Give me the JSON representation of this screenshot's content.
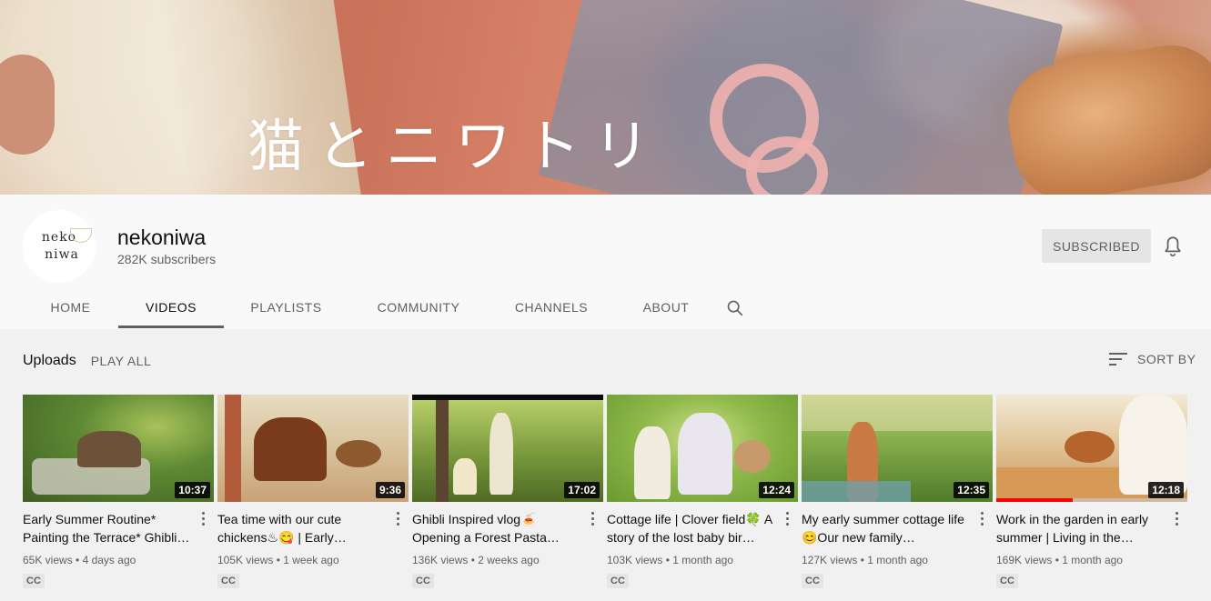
{
  "banner": {
    "title": "猫とニワトリ"
  },
  "channel": {
    "avatar_line1": "neko",
    "avatar_line2": "niwa",
    "name": "nekoniwa",
    "subscribers": "282K subscribers",
    "subscribe_label": "SUBSCRIBED"
  },
  "tabs": [
    {
      "label": "HOME"
    },
    {
      "label": "VIDEOS",
      "active": true
    },
    {
      "label": "PLAYLISTS"
    },
    {
      "label": "COMMUNITY"
    },
    {
      "label": "CHANNELS"
    },
    {
      "label": "ABOUT"
    }
  ],
  "uploads": {
    "title": "Uploads",
    "play_all": "PLAY ALL",
    "sort_by": "SORT BY"
  },
  "videos": [
    {
      "title": "Early Summer Routine* Painting the Terrace* Ghibli…",
      "duration": "10:37",
      "views": "65K views",
      "age": "4 days ago",
      "badge": "CC"
    },
    {
      "title": "Tea time with our cute chickens♨😋 | Early…",
      "duration": "9:36",
      "views": "105K views",
      "age": "1 week ago",
      "badge": "CC"
    },
    {
      "title": "Ghibli Inspired vlog🍝 Opening a Forest Pasta…",
      "duration": "17:02",
      "views": "136K views",
      "age": "2 weeks ago",
      "badge": "CC"
    },
    {
      "title": "Cottage life | Clover field🍀 A story of the lost baby bir…",
      "duration": "12:24",
      "views": "103K views",
      "age": "1 month ago",
      "badge": "CC"
    },
    {
      "title": "My early summer cottage life😊Our new family…",
      "duration": "12:35",
      "views": "127K views",
      "age": "1 month ago",
      "badge": "CC"
    },
    {
      "title": "Work in the garden in early summer | Living in the…",
      "duration": "12:18",
      "views": "169K views",
      "age": "1 month ago",
      "badge": "CC",
      "watched_fraction": 0.4
    }
  ]
}
